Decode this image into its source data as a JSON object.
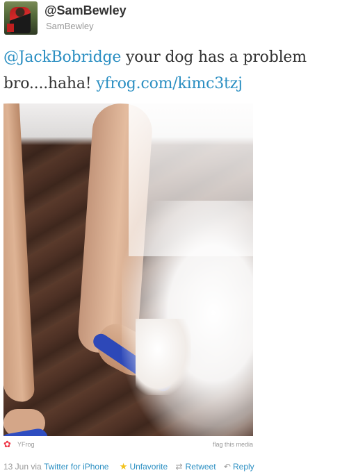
{
  "user": {
    "screen_name": "@SamBewley",
    "full_name": "SamBewley",
    "avatar_icon": "user-avatar"
  },
  "tweet": {
    "mention": "@JackBobridge",
    "text": " your dog has a problem bro....haha! ",
    "link": "yfrog.com/kimc3tzj"
  },
  "media": {
    "provider": "YFrog",
    "provider_icon": "yfrog-icon",
    "flag_label": "flag this media"
  },
  "footer": {
    "date": "13 Jun",
    "via": "via",
    "client": "Twitter for iPhone",
    "unfavorite_label": "Unfavorite",
    "retweet_label": "Retweet",
    "reply_label": "Reply"
  },
  "colors": {
    "link": "#2b8fc2",
    "meta": "#999999",
    "star": "#f2c21b"
  }
}
